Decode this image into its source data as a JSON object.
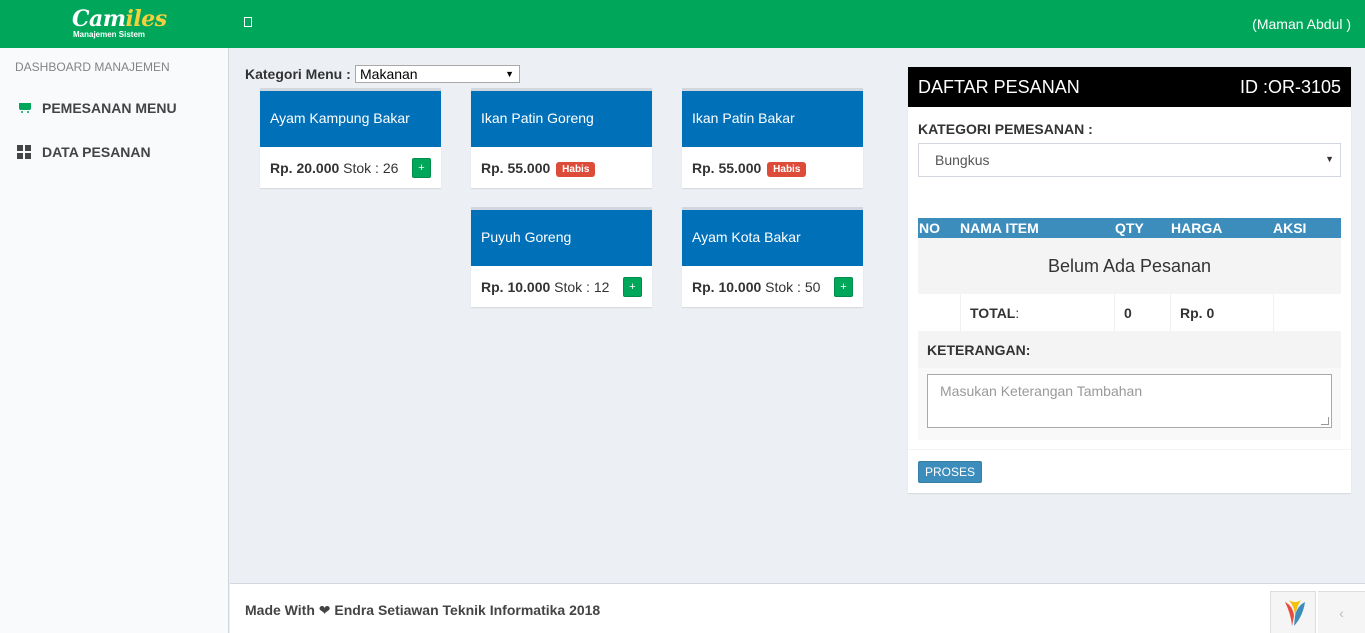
{
  "header": {
    "logo_main_1": "Cam",
    "logo_main_2": "iles",
    "logo_sub": "Manajemen Sistem",
    "user": "(Maman Abdul )"
  },
  "sidebar": {
    "section": "DASHBOARD MANAJEMEN",
    "items": [
      {
        "label": "PEMESANAN MENU",
        "icon": "shopping-cart-icon"
      },
      {
        "label": "DATA PESANAN",
        "icon": "dashboard-grid-icon"
      }
    ]
  },
  "menu": {
    "kategori_label": "Kategori Menu :",
    "kategori_value": "Makanan",
    "items": [
      {
        "name": "Ayam Kampung Bakar",
        "price": "Rp. 20.000",
        "stock": "Stok : 26",
        "add": "+"
      },
      {
        "name": "Ikan Patin Goreng",
        "price": "Rp. 55.000",
        "badge": "Habis"
      },
      {
        "name": "Ikan Patin Bakar",
        "price": "Rp. 55.000",
        "badge": "Habis"
      },
      {
        "name": "Puyuh Goreng",
        "price": "Rp. 10.000",
        "stock": "Stok : 12",
        "add": "+"
      },
      {
        "name": "Ayam Kota Bakar",
        "price": "Rp. 10.000",
        "stock": "Stok : 50",
        "add": "+"
      }
    ]
  },
  "order": {
    "title": "DAFTAR PESANAN",
    "id": "ID :OR-3105",
    "kategori_label": "KATEGORI PEMESANAN :",
    "kategori_value": "Bungkus",
    "columns": [
      "NO",
      "NAMA ITEM",
      "QTY",
      "HARGA",
      "AKSI"
    ],
    "empty": "Belum Ada Pesanan",
    "total_label": "TOTAL",
    "total_colon": ":",
    "total_qty": "0",
    "total_price": "Rp. 0",
    "keterangan_label": "KETERANGAN:",
    "keterangan_placeholder": "Masukan Keterangan Tambahan",
    "proses": "PROSES"
  },
  "footer": {
    "text": "Made With ❤ Endra Setiawan Teknik Informatika 2018"
  }
}
